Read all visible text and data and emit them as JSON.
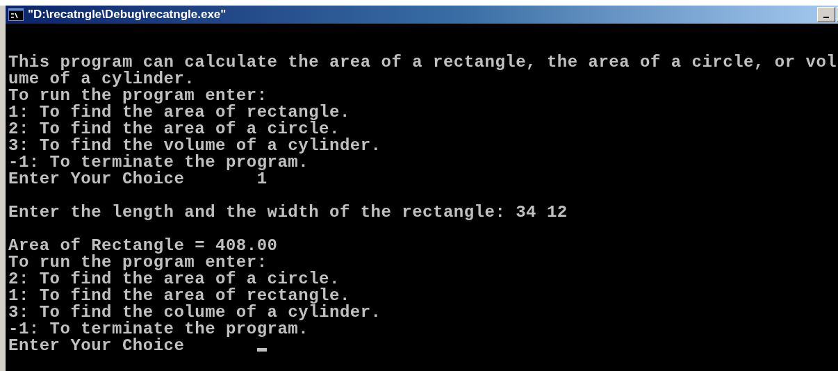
{
  "window": {
    "title": "\"D:\\recatngle\\Debug\\recatngle.exe\""
  },
  "console": {
    "lines": [
      {
        "kind": "text",
        "text": "This program can calculate the area of a rectangle, the area of a circle, or vol",
        "cursor": false
      },
      {
        "kind": "text",
        "text": "ume of a cylinder.",
        "cursor": false
      },
      {
        "kind": "text",
        "text": "To run the program enter:",
        "cursor": false
      },
      {
        "kind": "text",
        "text": "1: To find the area of rectangle.",
        "cursor": false
      },
      {
        "kind": "text",
        "text": "2: To find the area of a circle.",
        "cursor": false
      },
      {
        "kind": "text",
        "text": "3: To find the volume of a cylinder.",
        "cursor": false
      },
      {
        "kind": "text",
        "text": "-1: To terminate the program.",
        "cursor": false
      },
      {
        "kind": "text",
        "text": "Enter Your Choice       1",
        "cursor": false
      },
      {
        "kind": "blank"
      },
      {
        "kind": "text",
        "text": "Enter the length and the width of the rectangle: 34 12",
        "cursor": false
      },
      {
        "kind": "blank"
      },
      {
        "kind": "text",
        "text": "Area of Rectangle = 408.00",
        "cursor": false
      },
      {
        "kind": "text",
        "text": "To run the program enter:",
        "cursor": false
      },
      {
        "kind": "text",
        "text": "2: To find the area of a circle.",
        "cursor": false
      },
      {
        "kind": "text",
        "text": "1: To find the area of rectangle.",
        "cursor": false
      },
      {
        "kind": "text",
        "text": "3: To find the colume of a cylinder.",
        "cursor": false
      },
      {
        "kind": "text",
        "text": "-1: To terminate the program.",
        "cursor": false
      },
      {
        "kind": "text",
        "text": "Enter Your Choice       ",
        "cursor": true
      }
    ]
  }
}
